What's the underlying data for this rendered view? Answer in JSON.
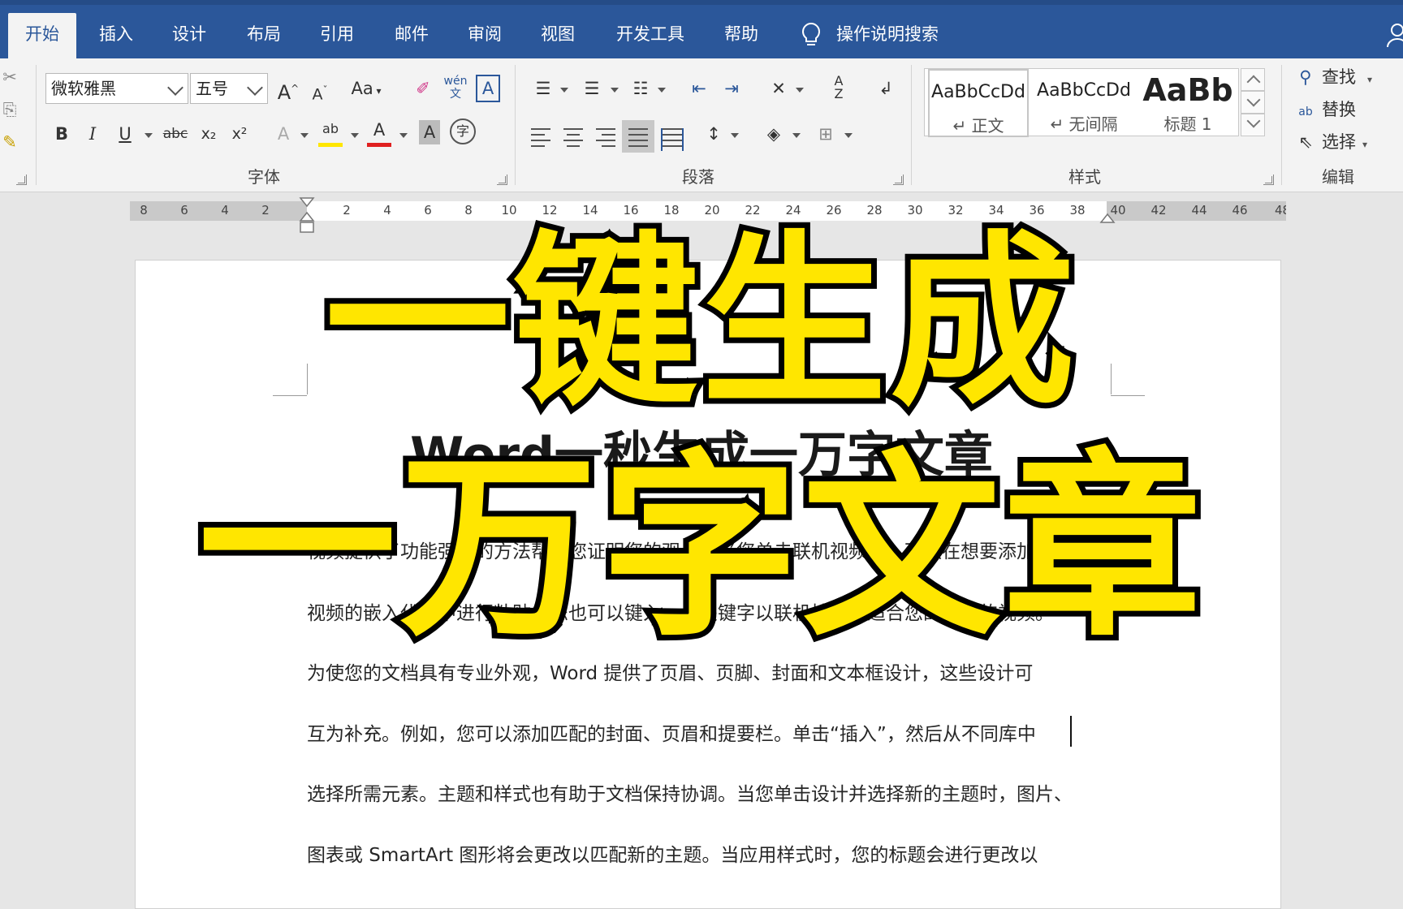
{
  "tabs": [
    "开始",
    "插入",
    "设计",
    "布局",
    "引用",
    "邮件",
    "审阅",
    "视图",
    "开发工具",
    "帮助"
  ],
  "active_tab": "开始",
  "tell_me": "操作说明搜索",
  "font": {
    "name": "微软雅黑",
    "size": "五号",
    "group_label": "字体"
  },
  "font_buttons": [
    "B",
    "I",
    "U",
    "abc",
    "x₂",
    "x²"
  ],
  "paragraph": {
    "group_label": "段落"
  },
  "styles": {
    "group_label": "样式",
    "items": [
      {
        "sample": "AaBbCcDd",
        "name": "↵ 正文"
      },
      {
        "sample": "AaBbCcDd",
        "name": "↵ 无间隔"
      },
      {
        "sample": "AaBb",
        "name": "标题 1"
      }
    ]
  },
  "editing": {
    "group_label": "编辑",
    "find": "查找",
    "replace": "替换",
    "select": "选择"
  },
  "ruler_numbers": [
    "8",
    "6",
    "4",
    "2",
    "2",
    "4",
    "6",
    "8",
    "10",
    "12",
    "14",
    "16",
    "18",
    "20",
    "22",
    "24",
    "26",
    "28",
    "30",
    "32",
    "34",
    "36",
    "38",
    "40",
    "42",
    "44",
    "46",
    "48"
  ],
  "document": {
    "title": "Word一秒生成一万字文章",
    "lines": [
      "视频提供了功能强大的方法帮助您证明您的观点。当您单击联机视频时，可以在想要添加的",
      "视频的嵌入代码中进行粘贴。您也可以键入一个关键字以联机搜索最适合您的文档的视频。",
      "为使您的文档具有专业外观，Word 提供了页眉、页脚、封面和文本框设计，这些设计可",
      "互为补充。例如，您可以添加匹配的封面、页眉和提要栏。单击“插入”，然后从不同库中",
      "选择所需元素。主题和样式也有助于文档保持协调。当您单击设计并选择新的主题时，图片、",
      "图表或 SmartArt 图形将会更改以匹配新的主题。当应用样式时，您的标题会进行更改以"
    ]
  },
  "overlay": {
    "line1": "一键生成",
    "line2": "一万字文章"
  },
  "colors": {
    "ribbon_blue": "#2b579a",
    "overlay_yellow": "#ffe600"
  }
}
